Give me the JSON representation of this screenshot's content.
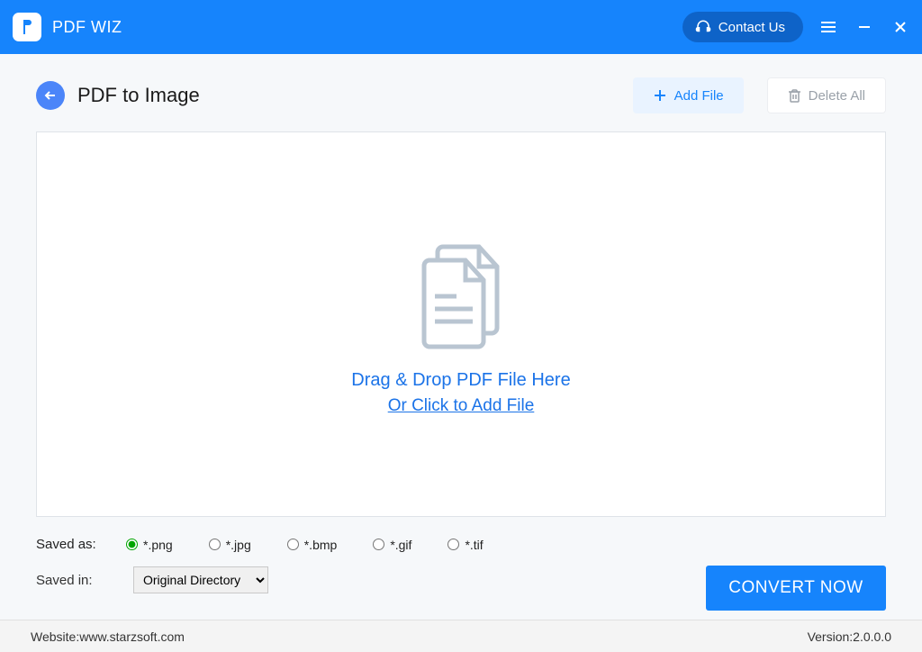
{
  "titlebar": {
    "app_name": "PDF WIZ",
    "contact_label": "Contact Us"
  },
  "header": {
    "page_title": "PDF to Image",
    "add_file_label": "Add File",
    "delete_all_label": "Delete All"
  },
  "dropzone": {
    "line1": "Drag & Drop PDF File Here",
    "line2": "Or Click to Add File"
  },
  "options": {
    "saved_as_label": "Saved as:",
    "formats": [
      "*.png",
      "*.jpg",
      "*.bmp",
      "*.gif",
      "*.tif"
    ],
    "selected_format_index": 0,
    "saved_in_label": "Saved in:",
    "directory_options": [
      "Original Directory"
    ],
    "selected_directory": "Original Directory"
  },
  "actions": {
    "convert_label": "CONVERT NOW"
  },
  "footer": {
    "website_label": "Website: ",
    "website_url": "www.starzsoft.com",
    "version_label": "Version: ",
    "version_value": "2.0.0.0"
  }
}
